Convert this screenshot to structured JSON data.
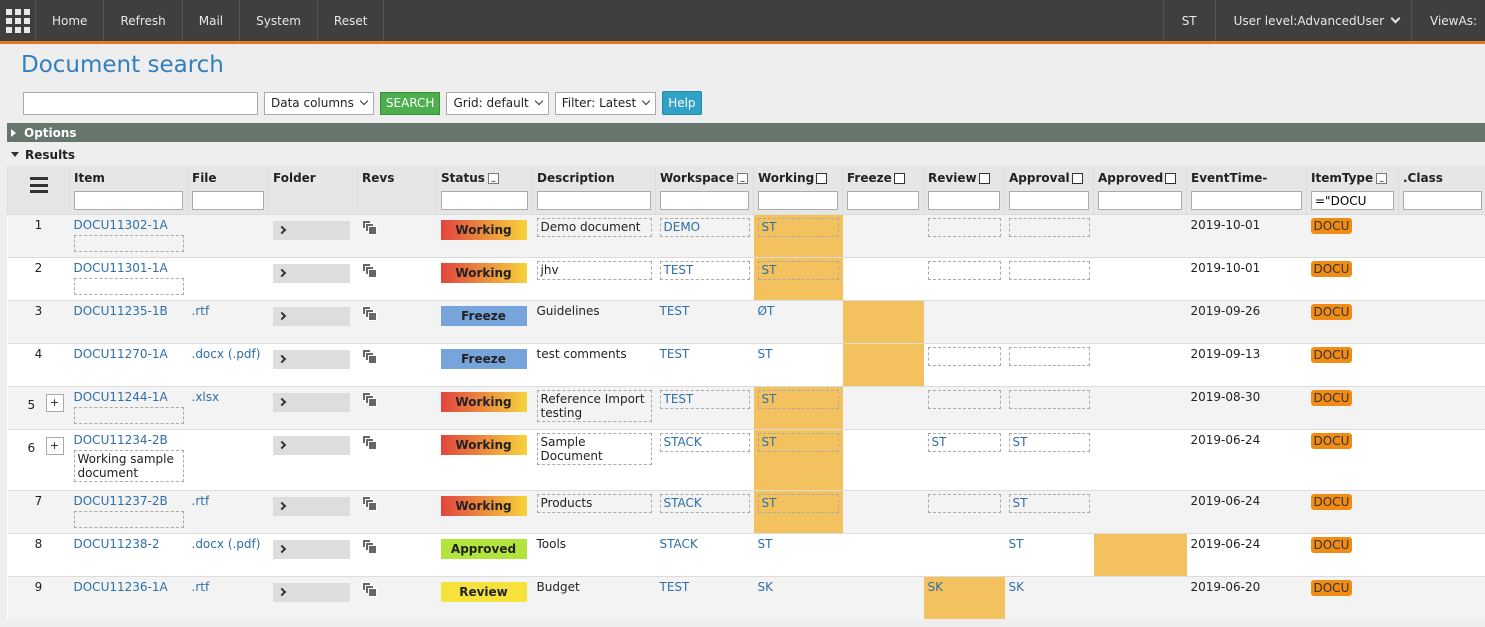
{
  "nav": {
    "items": [
      "Home",
      "Refresh",
      "Mail",
      "System",
      "Reset"
    ],
    "user": "ST",
    "user_level": "User level:AdvancedUser",
    "views_as": "ViewAs:"
  },
  "page": {
    "title": "Document search"
  },
  "toolbar": {
    "search_value": "",
    "data_columns": "Data columns",
    "search": "SEARCH",
    "grid": "Grid: default",
    "filter": "Filter: Latest",
    "help": "Help"
  },
  "sections": {
    "options": "Options",
    "results": "Results"
  },
  "columns": {
    "item": "Item",
    "file": "File",
    "folder": "Folder",
    "revs": "Revs",
    "status": "Status",
    "description": "Description",
    "workspace": "Workspace",
    "working": "Working",
    "freeze": "Freeze",
    "review": "Review",
    "approval": "Approval",
    "approved": "Approved",
    "eventtime": "EventTime-",
    "itemtype": "ItemType",
    "class": ".Class",
    "itemtype_filter": "=\"DOCU"
  },
  "rows": [
    {
      "num": "1",
      "item": "DOCU11302-1A",
      "file": "",
      "file_alt": "",
      "status": "Working",
      "description": "Demo document",
      "workspace": "DEMO",
      "working": "ST",
      "freeze": "",
      "review": "",
      "approval": "",
      "approved": "",
      "eventtime": "2019-10-01",
      "itemtype": "DOCU",
      "item_note": ""
    },
    {
      "num": "2",
      "item": "DOCU11301-1A",
      "file": "",
      "file_alt": "",
      "status": "Working",
      "description": "jhv",
      "workspace": "TEST",
      "working": "ST",
      "freeze": "",
      "review": "",
      "approval": "",
      "approved": "",
      "eventtime": "2019-10-01",
      "itemtype": "DOCU",
      "item_note": ""
    },
    {
      "num": "3",
      "item": "DOCU11235-1B",
      "file": ".rtf",
      "file_alt": "",
      "status": "Freeze",
      "description": "Guidelines",
      "workspace": "TEST",
      "working": "ØT",
      "freeze": "",
      "review": "",
      "approval": "",
      "approved": "",
      "eventtime": "2019-09-26",
      "itemtype": "DOCU",
      "item_note": ""
    },
    {
      "num": "4",
      "item": "DOCU11270-1A",
      "file": ".docx",
      "file_alt": "(.pdf)",
      "status": "Freeze",
      "description": "test comments",
      "workspace": "TEST",
      "working": "ST",
      "freeze": "",
      "review": "",
      "approval": "",
      "approved": "",
      "eventtime": "2019-09-13",
      "itemtype": "DOCU",
      "item_note": ""
    },
    {
      "num": "5",
      "item": "DOCU11244-1A",
      "file": ".xlsx",
      "file_alt": "",
      "status": "Working",
      "description": "Reference Import testing",
      "workspace": "TEST",
      "working": "ST",
      "freeze": "",
      "review": "",
      "approval": "",
      "approved": "",
      "eventtime": "2019-08-30",
      "itemtype": "DOCU",
      "item_note": ""
    },
    {
      "num": "6",
      "item": "DOCU11234-2B",
      "file": "",
      "file_alt": "",
      "status": "Working",
      "description": "Sample Document",
      "workspace": "STACK",
      "working": "ST",
      "freeze": "",
      "review": "ST",
      "approval": "ST",
      "approved": "",
      "eventtime": "2019-06-24",
      "itemtype": "DOCU",
      "item_note": "Working sample document"
    },
    {
      "num": "7",
      "item": "DOCU11237-2B",
      "file": ".rtf",
      "file_alt": "",
      "status": "Working",
      "description": "Products",
      "workspace": "STACK",
      "working": "ST",
      "freeze": "",
      "review": "",
      "approval": "ST",
      "approved": "",
      "eventtime": "2019-06-24",
      "itemtype": "DOCU",
      "item_note": ""
    },
    {
      "num": "8",
      "item": "DOCU11238-2",
      "file": ".docx",
      "file_alt": "(.pdf)",
      "status": "Approved",
      "description": "Tools",
      "workspace": "STACK",
      "working": "ST",
      "freeze": "",
      "review": "",
      "approval": "ST",
      "approved": "",
      "eventtime": "2019-06-24",
      "itemtype": "DOCU",
      "item_note": ""
    },
    {
      "num": "9",
      "item": "DOCU11236-1A",
      "file": ".rtf",
      "file_alt": "",
      "status": "Review",
      "description": "Budget",
      "workspace": "TEST",
      "working": "SK",
      "freeze": "",
      "review": "SK",
      "approval": "SK",
      "approved": "",
      "eventtime": "2019-06-20",
      "itemtype": "DOCU",
      "item_note": ""
    }
  ],
  "icons": {
    "apps": "grid-icon",
    "menu": "hamburger-icon",
    "revs": "revisions-icon",
    "folder": "chevron-right-icon",
    "expand": "plus-icon"
  },
  "colors": {
    "accent": "#e27b1e",
    "title": "#2f7fc1",
    "highlight": "#f3c25e",
    "badge": "#f08b14"
  }
}
